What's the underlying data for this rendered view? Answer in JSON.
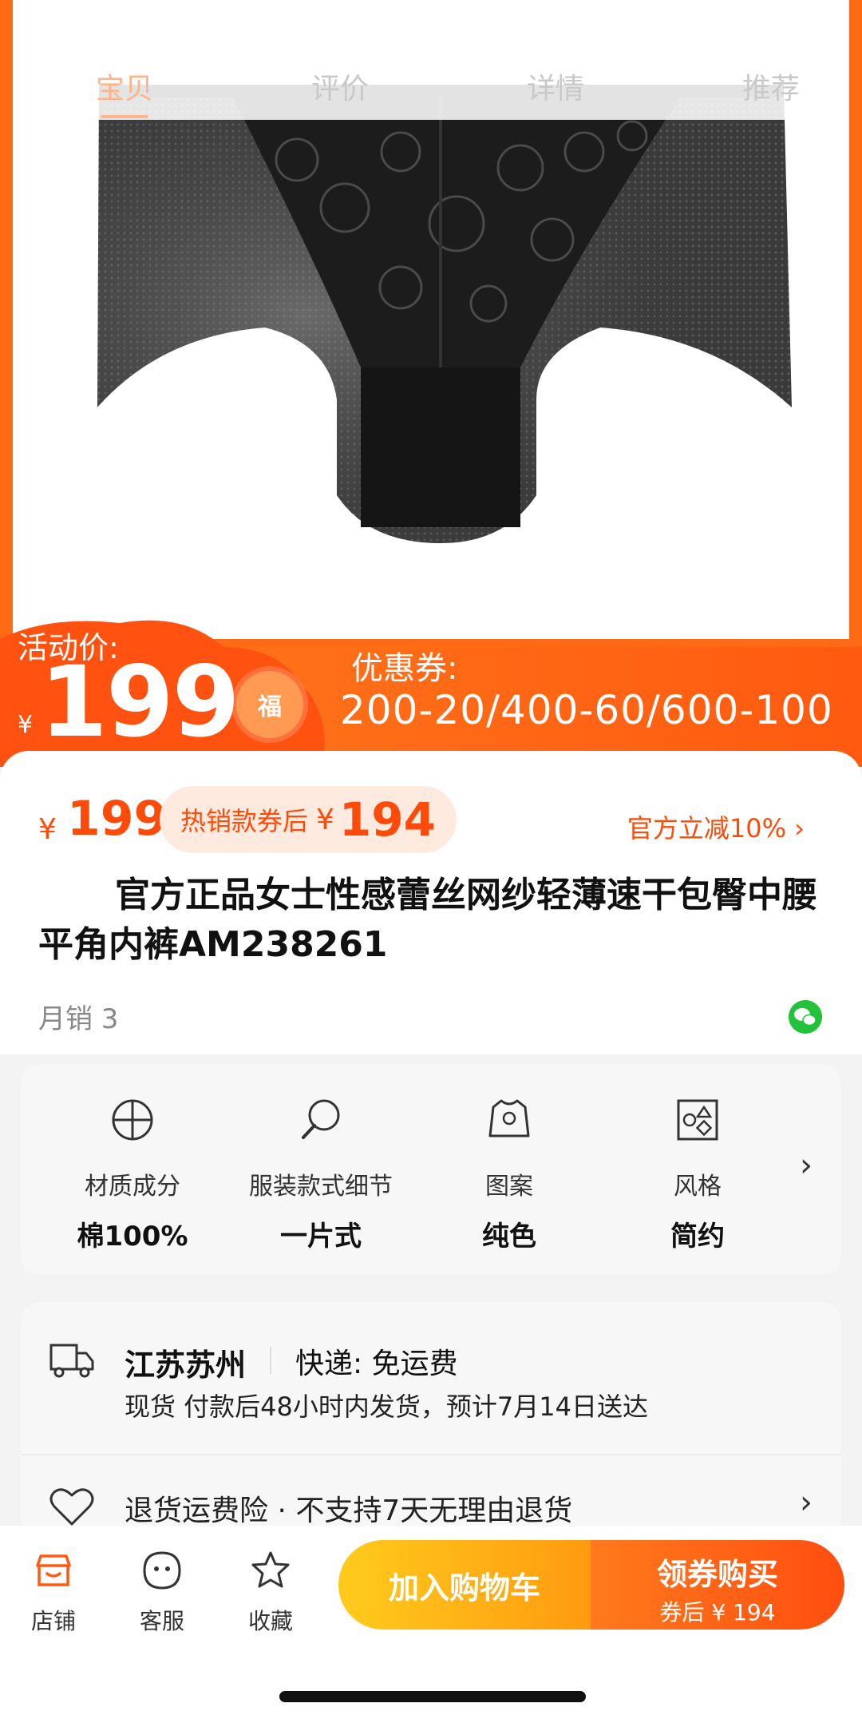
{
  "header": {
    "tabs": [
      {
        "label": "宝贝"
      },
      {
        "label": "评价"
      },
      {
        "label": "详情"
      },
      {
        "label": "推荐"
      }
    ]
  },
  "promo": {
    "activity_label": "活动价:",
    "currency": "¥",
    "activity_price": "199",
    "coupon_label": "优惠券:",
    "coupon_values": "200-20/400-60/600-100",
    "badge_text": "福"
  },
  "price": {
    "currency": "¥",
    "value": "199",
    "coupon_pill_text": "热销款券后",
    "coupon_currency": "¥",
    "coupon_price": "194",
    "official_discount": "官方立减10% ›"
  },
  "product": {
    "title": "官方正品女士性感蕾丝网纱轻薄速干包臀中腰平角内裤AM238261",
    "monthly_sales": "月销 3"
  },
  "attributes": [
    {
      "label": "材质成分",
      "value": "棉100%",
      "icon": "material-icon"
    },
    {
      "label": "服装款式细节",
      "value": "一片式",
      "icon": "magnifier-icon"
    },
    {
      "label": "图案",
      "value": "纯色",
      "icon": "shirt-icon"
    },
    {
      "label": "风格",
      "value": "简约",
      "icon": "shapes-icon"
    }
  ],
  "shipping": {
    "origin": "江苏苏州",
    "method": "快递: 免运费",
    "delivery": "现货 付款后48小时内发货，预计7月14日送达",
    "return_policy": "退货运费险 · 不支持7天无理由退货"
  },
  "bottom_bar": {
    "shop": "店铺",
    "service": "客服",
    "favorite": "收藏",
    "add_to_cart": "加入购物车",
    "buy_label": "领券购买",
    "buy_sub": "券后 ¥ 194"
  },
  "colors": {
    "accent": "#ff4b0a",
    "banner": "#ff6a14",
    "cart_button": "#ffb414",
    "wechat": "#22c23b"
  }
}
